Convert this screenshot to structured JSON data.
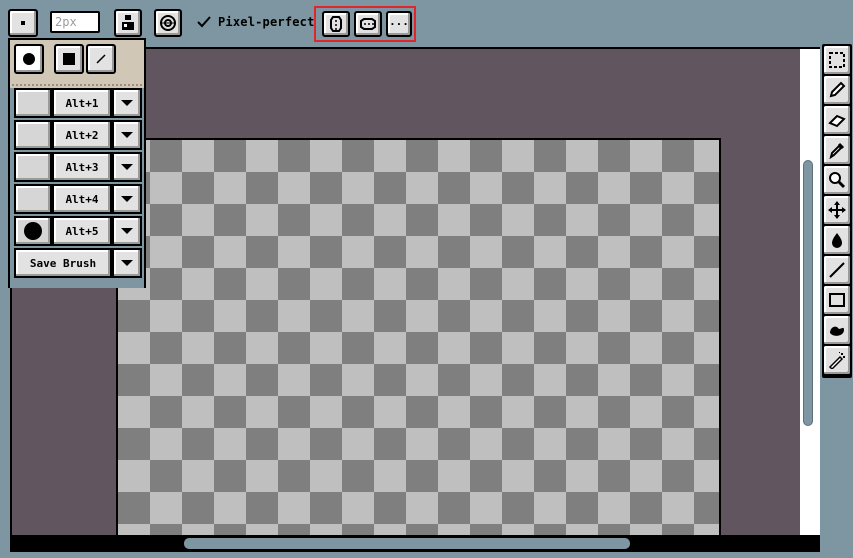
{
  "toolbar": {
    "brush_size_value": "2px",
    "pixel_perfect_label": "Pixel-perfect",
    "pixel_perfect_checked": true,
    "more_label": "...",
    "icons": {
      "brush_type": "square-dot-icon",
      "ink": "ink-bottle-icon",
      "symmetry": "target-icon",
      "check": "checkmark-icon",
      "selection_vertical": "vertical-symmetry-icon",
      "selection_horizontal": "horizontal-symmetry-icon"
    }
  },
  "brush_popup": {
    "shapes": [
      "circle-brush",
      "square-brush",
      "line-brush"
    ],
    "slots": [
      {
        "shortcut": "Alt+1",
        "has_brush": false
      },
      {
        "shortcut": "Alt+2",
        "has_brush": false
      },
      {
        "shortcut": "Alt+3",
        "has_brush": false
      },
      {
        "shortcut": "Alt+4",
        "has_brush": false
      },
      {
        "shortcut": "Alt+5",
        "has_brush": true
      }
    ],
    "save_label": "Save Brush"
  },
  "tools": [
    "rectangular-marquee-icon",
    "pencil-icon",
    "eraser-icon",
    "eyedropper-icon",
    "zoom-icon",
    "move-icon",
    "paint-bucket-icon",
    "line-icon",
    "rectangle-icon",
    "contour-icon",
    "spray-icon"
  ],
  "colors": {
    "window_bg": "#7d96a1",
    "workspace_bg": "#615560",
    "checker_light": "#bfbfbf",
    "checker_dark": "#7f7f7f",
    "highlight_red": "#e0262b",
    "popup_bg": "#d1c7b6"
  }
}
